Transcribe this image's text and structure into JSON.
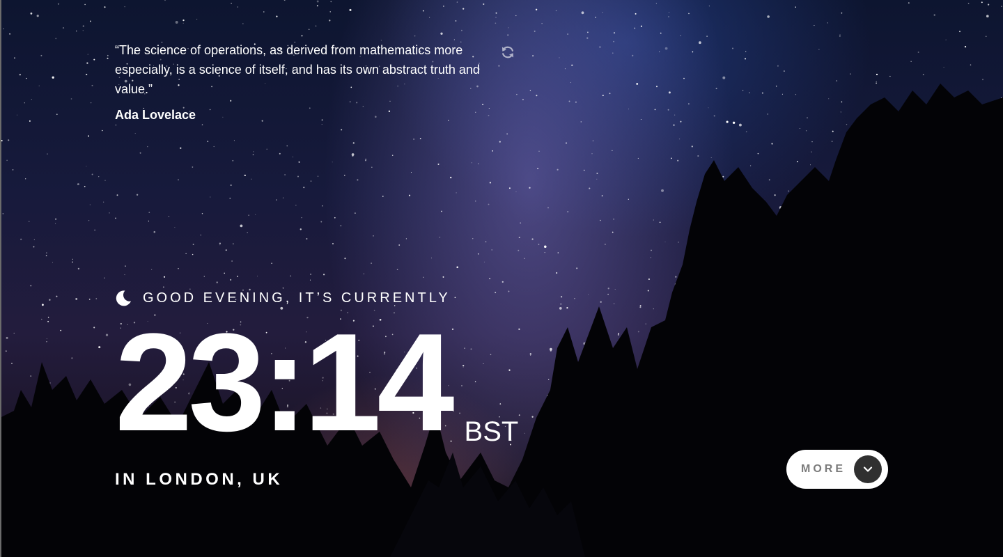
{
  "quote": {
    "text": "“The science of operations, as derived from mathematics more especially, is a science of itself, and has its own abstract truth and value.”",
    "author": "Ada Lovelace"
  },
  "icons": {
    "refresh": "refresh-icon",
    "greeting": "moon-icon",
    "more": "chevron-down-icon"
  },
  "greeting": {
    "text": "GOOD EVENING, IT’S CURRENTLY"
  },
  "clock": {
    "time": "23:14",
    "timezone": "BST"
  },
  "location": {
    "text": "IN LONDON, UK"
  },
  "more_button": {
    "label": "MORE"
  },
  "colors": {
    "text": "#ffffff",
    "button_bg": "#ffffff",
    "button_label": "#7b7b7b",
    "button_icon_bg": "#303030"
  }
}
